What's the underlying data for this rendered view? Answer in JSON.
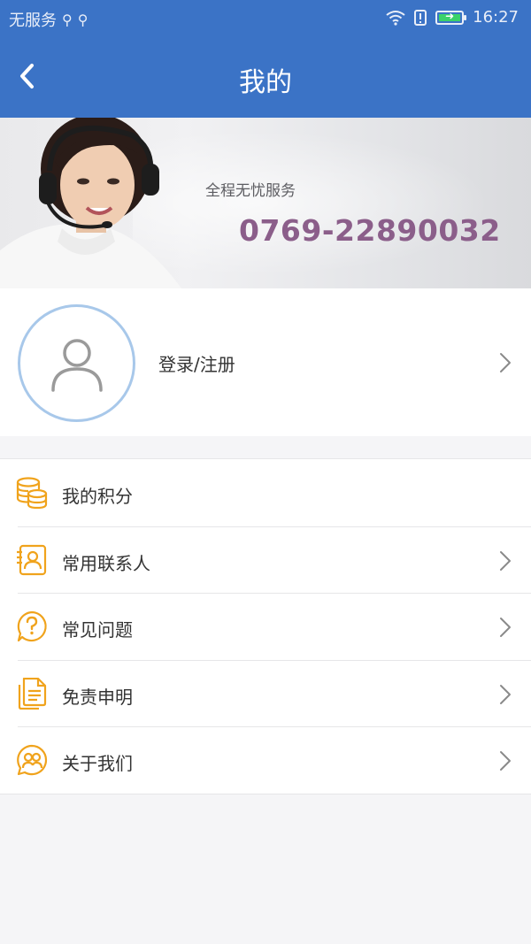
{
  "status_bar": {
    "carrier": "无服务",
    "time": "16:27",
    "battery_color": "#3bd26a"
  },
  "nav": {
    "title": "我的",
    "back_icon": "chevron-left-icon"
  },
  "banner": {
    "slogan": "全程无忧服务",
    "phone": "0769-22890032",
    "phone_color": "#8b5e8a"
  },
  "profile": {
    "login_label": "登录/注册",
    "avatar_icon": "user-icon"
  },
  "menu": {
    "items": [
      {
        "label": "我的积分",
        "icon": "coins-icon",
        "has_arrow": false
      },
      {
        "label": "常用联系人",
        "icon": "contact-card-icon",
        "has_arrow": true
      },
      {
        "label": "常见问题",
        "icon": "question-icon",
        "has_arrow": true
      },
      {
        "label": "免责申明",
        "icon": "document-icon",
        "has_arrow": true
      },
      {
        "label": "关于我们",
        "icon": "about-us-icon",
        "has_arrow": true
      }
    ]
  },
  "colors": {
    "brand_blue": "#3b73c6",
    "icon_orange": "#f0a31c",
    "avatar_ring": "#a8c8ea"
  }
}
